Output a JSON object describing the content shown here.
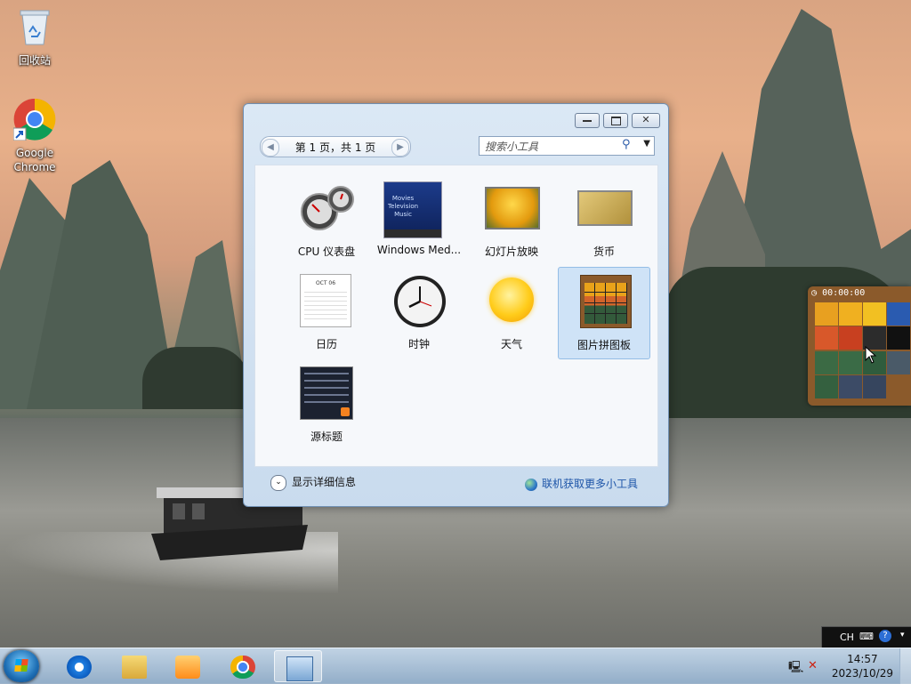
{
  "desktop": {
    "icons": [
      {
        "label": "回收站"
      },
      {
        "label": "Google Chrome"
      }
    ]
  },
  "gadget_window": {
    "page_indicator": "第 1 页，共 1 页",
    "search_placeholder": "搜索小工具",
    "gadgets": [
      {
        "name": "CPU 仪表盘"
      },
      {
        "name": "Windows Med..."
      },
      {
        "name": "幻灯片放映"
      },
      {
        "name": "货币"
      },
      {
        "name": "日历"
      },
      {
        "name": "时钟"
      },
      {
        "name": "天气"
      },
      {
        "name": "图片拼图板"
      },
      {
        "name": "源标题"
      }
    ],
    "thumb_texts": {
      "wmc_lines": [
        "Movies",
        "Television",
        "Music"
      ],
      "calendar_month": "OCT 06"
    },
    "show_details": "显示详细信息",
    "get_more_online": "联机获取更多小工具"
  },
  "puzzle_gadget": {
    "timer": "00:00:00"
  },
  "language_bar": {
    "lang": "CH"
  },
  "taskbar": {
    "time": "14:57",
    "date": "2023/10/29"
  },
  "colors": {
    "accent": "#1d55a8",
    "selection": "#cfe3f7"
  }
}
